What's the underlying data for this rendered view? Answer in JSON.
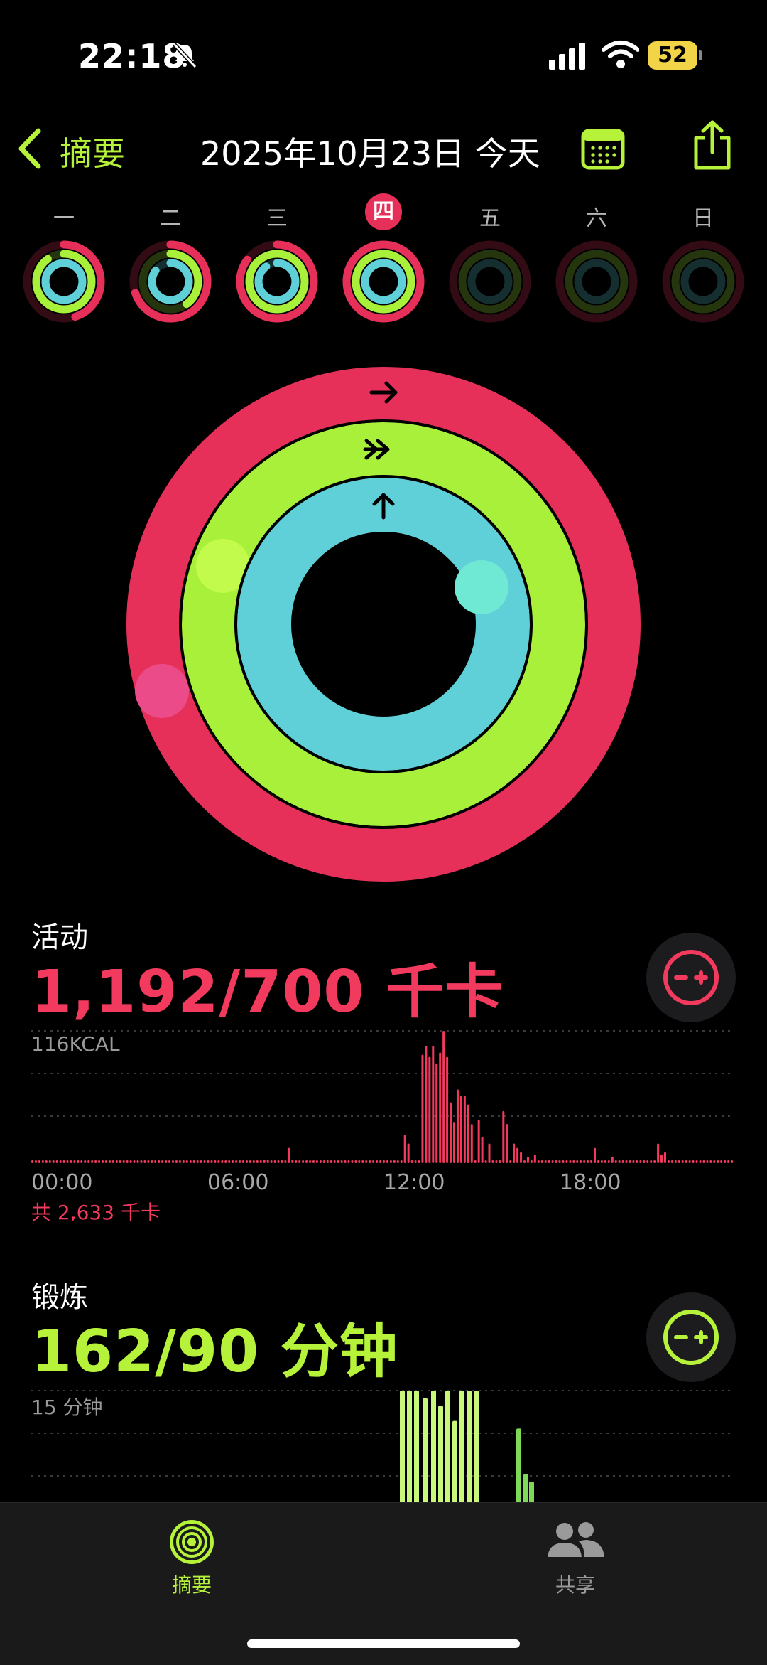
{
  "status_bar": {
    "time": "22:18",
    "battery": "52"
  },
  "nav": {
    "back_label": "摘要",
    "date_title": "2025年10月23日 今天"
  },
  "week": {
    "days": [
      "一",
      "二",
      "三",
      "四",
      "五",
      "六",
      "日"
    ],
    "selected_index": 3
  },
  "move": {
    "title": "活动",
    "value": "1,192/700 千卡",
    "chart_max_label": "116KCAL",
    "total": "共 2,633 千卡",
    "color": "#f23a5e"
  },
  "exercise": {
    "title": "锻炼",
    "value": "162/90 分钟",
    "chart_max_label": "15 分钟",
    "color": "#b6f23a"
  },
  "axis_times": [
    "00:00",
    "06:00",
    "12:00",
    "18:00"
  ],
  "tabs": [
    {
      "label": "摘要",
      "active": true
    },
    {
      "label": "共享",
      "active": false
    }
  ],
  "chart_data": [
    {
      "type": "bar",
      "title": "活动",
      "ylabel": "116KCAL",
      "x": [
        "00:00",
        "06:00",
        "12:00",
        "18:00"
      ],
      "series": [
        {
          "values": [
            2,
            2,
            2,
            2,
            2,
            2,
            2,
            2,
            2,
            2,
            2,
            2,
            2,
            2,
            2,
            2,
            2,
            2,
            2,
            2,
            2,
            2,
            2,
            2,
            2,
            2,
            2,
            2,
            2,
            2,
            2,
            2,
            2,
            2,
            2,
            2,
            2,
            2,
            2,
            2,
            2,
            2,
            2,
            2,
            2,
            2,
            2,
            2,
            2,
            2,
            2,
            2,
            2,
            2,
            2,
            2,
            2,
            2,
            2,
            2,
            2,
            2,
            2,
            2,
            2,
            2,
            3,
            3,
            2,
            2,
            2,
            2,
            2,
            14,
            3,
            2,
            2,
            2,
            2,
            2,
            2,
            2,
            2,
            2,
            2,
            2,
            2,
            2,
            2,
            2,
            2,
            2,
            2,
            2,
            2,
            2,
            2,
            2,
            2,
            2,
            2,
            2,
            2,
            2,
            2,
            2,
            26,
            18,
            2,
            2,
            2,
            100,
            108,
            98,
            108,
            92,
            102,
            122,
            98,
            56,
            38,
            68,
            62,
            62,
            54,
            36,
            2,
            40,
            24,
            2,
            18,
            2,
            2,
            2,
            48,
            36,
            2,
            18,
            14,
            10,
            2,
            6,
            2,
            8,
            2,
            2,
            2,
            2,
            2,
            2,
            2,
            2,
            2,
            2,
            2,
            2,
            2,
            2,
            2,
            2,
            14,
            2,
            2,
            2,
            2,
            6,
            2,
            2,
            2,
            2,
            2,
            2,
            2,
            2,
            2,
            2,
            2,
            2,
            18,
            8,
            10,
            2,
            2,
            2,
            2,
            2,
            2,
            2,
            2,
            2,
            2,
            2,
            2,
            2,
            2,
            2,
            2,
            2,
            2,
            2
          ]
        }
      ],
      "ylim": [
        0,
        122
      ]
    },
    {
      "type": "bar",
      "title": "锻炼",
      "ylabel": "15 分钟",
      "x": [
        "00:00",
        "06:00",
        "12:00",
        "18:00"
      ],
      "series": [
        {
          "values": [
            15,
            15,
            15,
            14,
            15,
            13,
            15,
            11,
            15,
            15,
            15,
            10,
            4,
            3
          ]
        }
      ],
      "ylim": [
        0,
        15
      ]
    }
  ]
}
